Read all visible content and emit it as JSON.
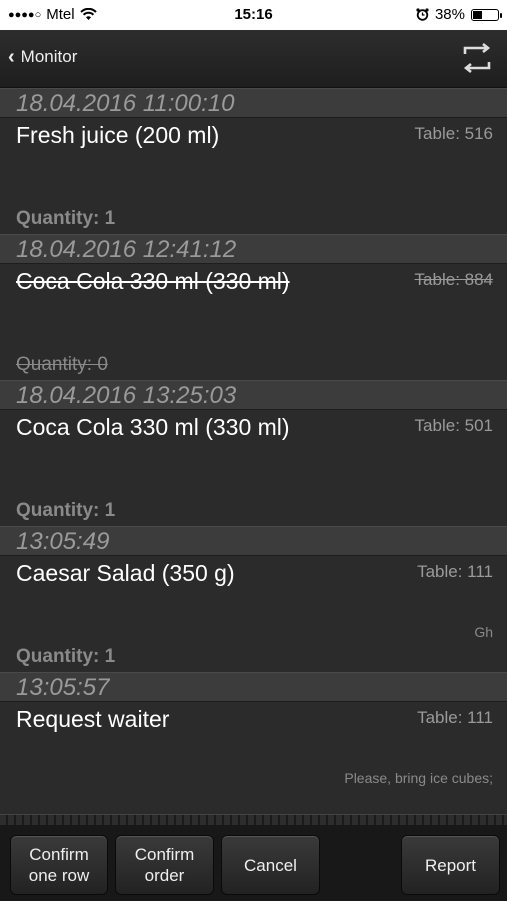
{
  "status_bar": {
    "signal": "●●●●○",
    "carrier": "Mtel",
    "time": "15:16",
    "battery": "38%",
    "battery_level": 0.38
  },
  "nav": {
    "back_label": "Monitor",
    "refresh_icon": "refresh-icon"
  },
  "orders": [
    {
      "timestamp": "18.04.2016 11:00:10",
      "item": "Fresh juice (200 ml)",
      "table": "Table: 516",
      "note": "",
      "quantity": "Quantity: 1",
      "cancelled": false
    },
    {
      "timestamp": "18.04.2016 12:41:12",
      "item": "Coca Cola 330 ml (330 ml)",
      "table": "Table: 884",
      "note": "",
      "quantity": "Quantity: 0",
      "cancelled": true
    },
    {
      "timestamp": "18.04.2016 13:25:03",
      "item": "Coca Cola 330 ml (330 ml)",
      "table": "Table: 501",
      "note": "",
      "quantity": "Quantity: 1",
      "cancelled": false
    },
    {
      "timestamp": "13:05:49",
      "item": "Caesar Salad (350 g)",
      "table": "Table: 111",
      "note": "Gh",
      "quantity": "Quantity: 1",
      "cancelled": false
    },
    {
      "timestamp": "13:05:57",
      "item": "Request waiter",
      "table": "Table: 111",
      "note": "Please, bring ice cubes;",
      "quantity": "",
      "cancelled": false
    }
  ],
  "toolbar": {
    "confirm_row": "Confirm\none row",
    "confirm_order": "Confirm\norder",
    "cancel": "Cancel",
    "report": "Report"
  }
}
